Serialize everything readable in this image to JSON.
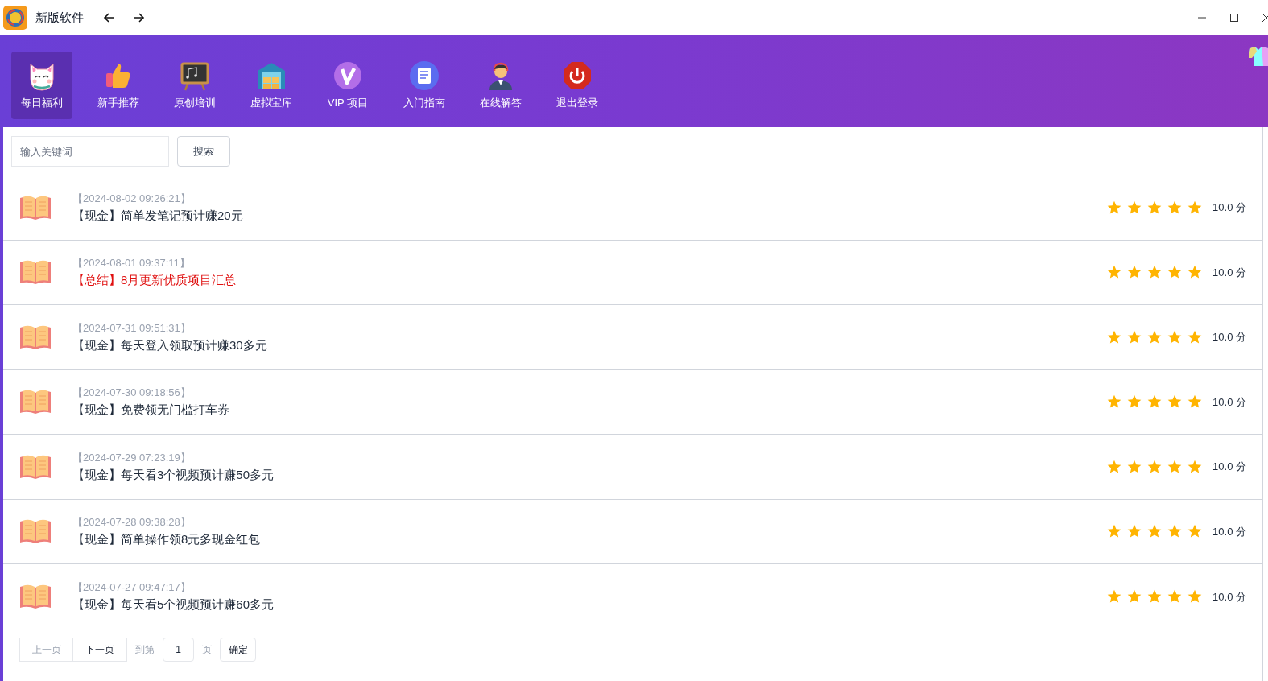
{
  "window": {
    "title": "新版软件"
  },
  "nav": [
    {
      "label": "每日福利",
      "selected": true,
      "kind": "cat"
    },
    {
      "label": "新手推荐",
      "selected": false,
      "kind": "thumb"
    },
    {
      "label": "原创培训",
      "selected": false,
      "kind": "board"
    },
    {
      "label": "虚拟宝库",
      "selected": false,
      "kind": "warehouse"
    },
    {
      "label": "VIP 项目",
      "selected": false,
      "kind": "vip"
    },
    {
      "label": "入门指南",
      "selected": false,
      "kind": "doc"
    },
    {
      "label": "在线解答",
      "selected": false,
      "kind": "agent"
    },
    {
      "label": "退出登录",
      "selected": false,
      "kind": "power"
    }
  ],
  "search": {
    "placeholder": "输入关键词",
    "button": "搜索"
  },
  "articles": [
    {
      "date": "【2024-08-02 09:26:21】",
      "title": "【现金】简单发笔记预计赚20元",
      "highlighted": false,
      "stars": 5,
      "score": "10.0 分"
    },
    {
      "date": "【2024-08-01 09:37:11】",
      "title": "【总结】8月更新优质项目汇总",
      "highlighted": true,
      "stars": 5,
      "score": "10.0 分"
    },
    {
      "date": "【2024-07-31 09:51:31】",
      "title": "【现金】每天登入领取预计赚30多元",
      "highlighted": false,
      "stars": 5,
      "score": "10.0 分"
    },
    {
      "date": "【2024-07-30 09:18:56】",
      "title": "【现金】免费领无门槛打车券",
      "highlighted": false,
      "stars": 5,
      "score": "10.0 分"
    },
    {
      "date": "【2024-07-29 07:23:19】",
      "title": "【现金】每天看3个视频预计赚50多元",
      "highlighted": false,
      "stars": 5,
      "score": "10.0 分"
    },
    {
      "date": "【2024-07-28 09:38:28】",
      "title": "【现金】简单操作领8元多现金红包",
      "highlighted": false,
      "stars": 5,
      "score": "10.0 分"
    },
    {
      "date": "【2024-07-27 09:47:17】",
      "title": "【现金】每天看5个视频预计赚60多元",
      "highlighted": false,
      "stars": 5,
      "score": "10.0 分"
    }
  ],
  "pagination": {
    "prev": {
      "label": "上一页",
      "disabled": true
    },
    "next": {
      "label": "下一页",
      "disabled": false
    },
    "goto_label": "到第",
    "page": "1",
    "page_suffix": "页",
    "confirm": "确定"
  }
}
